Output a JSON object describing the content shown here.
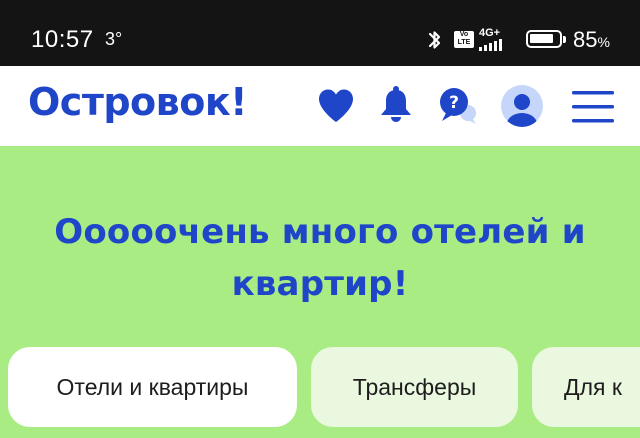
{
  "status_bar": {
    "time": "10:57",
    "temperature": "3°",
    "network_type": "4G+",
    "volte_label_top": "Vo",
    "volte_label_bottom": "LTE",
    "battery_percent": "85",
    "battery_percent_sign": "%",
    "battery_level": 0.85
  },
  "header": {
    "logo": "Островок!",
    "icons": [
      "heart-icon",
      "bell-icon",
      "help-icon",
      "avatar-icon",
      "menu-icon"
    ]
  },
  "hero": {
    "title_line1": "Ооооочень много отелей и",
    "title_line2": "квартир!"
  },
  "tabs": [
    {
      "label": "Отели и квартиры",
      "selected": true
    },
    {
      "label": "Трансферы",
      "selected": false
    },
    {
      "label": "Для к",
      "selected": false
    }
  ],
  "colors": {
    "brand_blue": "#1f45c9",
    "hero_green": "#a9ec84",
    "tab_inactive": "#e9f8df",
    "status_bar": "#141414"
  }
}
